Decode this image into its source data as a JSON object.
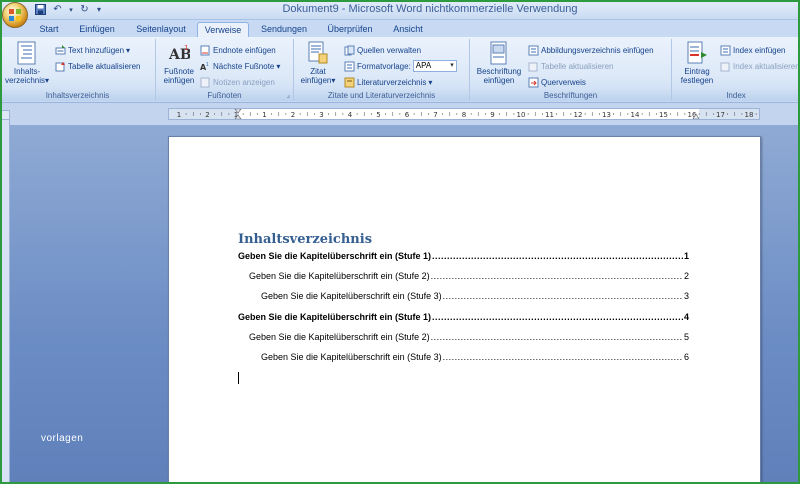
{
  "window": {
    "title": "Dokument9 - Microsoft Word nichtkommerzielle Verwendung"
  },
  "quick_access": {
    "save_icon": "save-icon",
    "undo_icon": "undo-icon",
    "redo_icon": "redo-icon"
  },
  "tabs": [
    {
      "label": "Start"
    },
    {
      "label": "Einfügen"
    },
    {
      "label": "Seitenlayout"
    },
    {
      "label": "Verweise",
      "active": true
    },
    {
      "label": "Sendungen"
    },
    {
      "label": "Überprüfen"
    },
    {
      "label": "Ansicht"
    }
  ],
  "ribbon": {
    "inhaltsverzeichnis": {
      "label": "Inhaltsverzeichnis",
      "big_button_line1": "Inhalts-",
      "big_button_line2": "verzeichnis",
      "text_hinzufuegen": "Text hinzufügen",
      "tabelle_aktualisieren": "Tabelle aktualisieren"
    },
    "fussnoten": {
      "label": "Fußnoten",
      "big_button_line1": "Fußnote",
      "big_button_line2": "einfügen",
      "endnote_einfuegen": "Endnote einfügen",
      "naechste_fussnote": "Nächste Fußnote",
      "notizen_anzeigen": "Notizen anzeigen"
    },
    "zitate": {
      "label": "Zitate und Literaturverzeichnis",
      "big_button_line1": "Zitat",
      "big_button_line2": "einfügen",
      "quellen_verwalten": "Quellen verwalten",
      "formatvorlage_label": "Formatvorlage:",
      "formatvorlage_value": "APA",
      "literaturverzeichnis": "Literaturverzeichnis"
    },
    "beschriftungen": {
      "label": "Beschriftungen",
      "big_button_line1": "Beschriftung",
      "big_button_line2": "einfügen",
      "abbildungsverzeichnis": "Abbildungsverzeichnis einfügen",
      "tabelle_aktualisieren": "Tabelle aktualisieren",
      "querverweis": "Querverweis"
    },
    "index": {
      "label": "Index",
      "big_button_line1": "Eintrag",
      "big_button_line2": "festlegen",
      "index_einfuegen": "Index einfügen",
      "index_aktualisieren": "Index aktualisieren"
    }
  },
  "ruler": {
    "numbers": [
      "1",
      "2",
      "1",
      "1",
      "2",
      "3",
      "4",
      "5",
      "6",
      "7",
      "8",
      "9",
      "10",
      "11",
      "12",
      "13",
      "14",
      "15",
      "16",
      "17",
      "18"
    ]
  },
  "document": {
    "toc_title": "Inhaltsverzeichnis",
    "entries": [
      {
        "text": "Geben Sie die Kapitelüberschrift ein (Stufe 1)",
        "page": "1",
        "level": 1
      },
      {
        "text": "Geben Sie die Kapitelüberschrift ein (Stufe 2)",
        "page": "2",
        "level": 2
      },
      {
        "text": "Geben Sie die Kapitelüberschrift ein (Stufe 3)",
        "page": "3",
        "level": 3
      },
      {
        "text": "Geben Sie die Kapitelüberschrift ein (Stufe 1)",
        "page": "4",
        "level": 1
      },
      {
        "text": "Geben Sie die Kapitelüberschrift ein (Stufe 2)",
        "page": "5",
        "level": 2
      },
      {
        "text": "Geben Sie die Kapitelüberschrift ein (Stufe 3)",
        "page": "6",
        "level": 3
      }
    ]
  },
  "watermark": "vorlagen"
}
